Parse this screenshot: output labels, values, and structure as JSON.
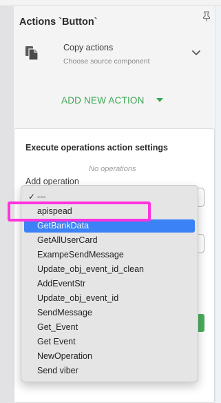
{
  "panel": {
    "title": "Actions `Button`",
    "copy_actions": {
      "title": "Copy actions",
      "subtitle": "Choose source component"
    },
    "add_new_action_label": "ADD NEW ACTION"
  },
  "settings": {
    "title": "Execute operations action settings",
    "no_operations": "No operations",
    "add_operation_label": "Add operation"
  },
  "dropdown": {
    "checkmark": "✓",
    "selected_index": 2,
    "checked_index": 0,
    "options": [
      "---",
      "apispead",
      "GetBankData",
      "GetAllUserCard",
      "ExampeSendMessage",
      "Update_obj_event_id_clean",
      "AddEventStr",
      "Update_obj_event_id",
      "SendMessage",
      "Get_Event",
      "Get Event",
      "NewOperation",
      "Send viber"
    ]
  },
  "colors": {
    "accent_green": "#3aa751",
    "selection_blue": "#3a82f6",
    "annotation_magenta": "#ff33dd"
  },
  "icons": {
    "pin": "pin-icon",
    "copy": "copy-icon",
    "chevron": "chevron-down-icon",
    "caret": "caret-down-icon"
  }
}
